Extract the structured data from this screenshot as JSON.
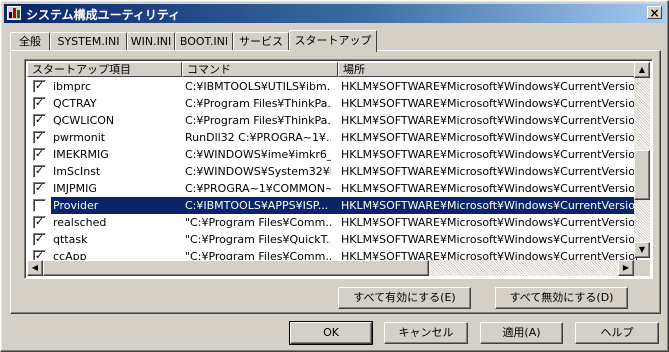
{
  "window": {
    "title": "システム構成ユーティリティ",
    "close_label": "×"
  },
  "tabs": [
    {
      "label": "全般"
    },
    {
      "label": "SYSTEM.INI"
    },
    {
      "label": "WIN.INI"
    },
    {
      "label": "BOOT.INI"
    },
    {
      "label": "サービス"
    },
    {
      "label": "スタートアップ"
    }
  ],
  "active_tab": "スタートアップ",
  "list": {
    "columns": [
      "スタートアップ項目",
      "コマンド",
      "場所"
    ],
    "rows": [
      {
        "checked": true,
        "item": "ibmprc",
        "command": "C:¥IBMTOOLS¥UTILS¥ibm...",
        "location": "HKLM¥SOFTWARE¥Microsoft¥Windows¥CurrentVersion¥"
      },
      {
        "checked": true,
        "item": "QCTRAY",
        "command": "C:¥Program Files¥ThinkPa...",
        "location": "HKLM¥SOFTWARE¥Microsoft¥Windows¥CurrentVersion¥"
      },
      {
        "checked": true,
        "item": "QCWLICON",
        "command": "C:¥Program Files¥ThinkPa...",
        "location": "HKLM¥SOFTWARE¥Microsoft¥Windows¥CurrentVersion¥"
      },
      {
        "checked": true,
        "item": "pwrmonit",
        "command": "RunDll32 C:¥PROGRA~1¥...",
        "location": "HKLM¥SOFTWARE¥Microsoft¥Windows¥CurrentVersion¥"
      },
      {
        "checked": true,
        "item": "IMEKRMIG",
        "command": "C:¥WINDOWS¥ime¥imkr6_1...",
        "location": "HKLM¥SOFTWARE¥Microsoft¥Windows¥CurrentVersion¥"
      },
      {
        "checked": true,
        "item": "ImScInst",
        "command": "C:¥WINDOWS¥System32¥I...",
        "location": "HKLM¥SOFTWARE¥Microsoft¥Windows¥CurrentVersion¥"
      },
      {
        "checked": true,
        "item": "IMJPMIG",
        "command": "C:¥PROGRA~1¥COMMON~...",
        "location": "HKLM¥SOFTWARE¥Microsoft¥Windows¥CurrentVersion¥"
      },
      {
        "checked": false,
        "item": "Provider",
        "command": "C:¥IBMTOOLS¥APPS¥ISP...",
        "location": "HKLM¥SOFTWARE¥Microsoft¥Windows¥CurrentVersion¥",
        "selected": true
      },
      {
        "checked": true,
        "item": "realsched",
        "command": "\"C:¥Program Files¥Comm...",
        "location": "HKLM¥SOFTWARE¥Microsoft¥Windows¥CurrentVersion¥"
      },
      {
        "checked": true,
        "item": "qttask",
        "command": "\"C:¥Program Files¥QuickT...",
        "location": "HKLM¥SOFTWARE¥Microsoft¥Windows¥CurrentVersion¥"
      },
      {
        "checked": true,
        "item": "ccApp",
        "command": "\"C:¥Program Files¥Comm...",
        "location": "HKLM¥SOFTWARE¥Microsoft¥Windows¥CurrentVersion¥"
      }
    ]
  },
  "buttons": {
    "enable_all": "すべて有効にする(E)",
    "disable_all": "すべて無効にする(D)",
    "ok": "OK",
    "cancel": "キャンセル",
    "apply": "適用(A)",
    "help": "ヘルプ"
  },
  "scroll": {
    "up_arrow": "▲",
    "down_arrow": "▼",
    "left_arrow": "◀",
    "right_arrow": "▶"
  },
  "check_glyph": "✓",
  "colors": {
    "title_gradient_start": "#0a246a",
    "title_gradient_end": "#a6caf0",
    "face": "#d4d0c8",
    "selection": "#0a246a"
  }
}
